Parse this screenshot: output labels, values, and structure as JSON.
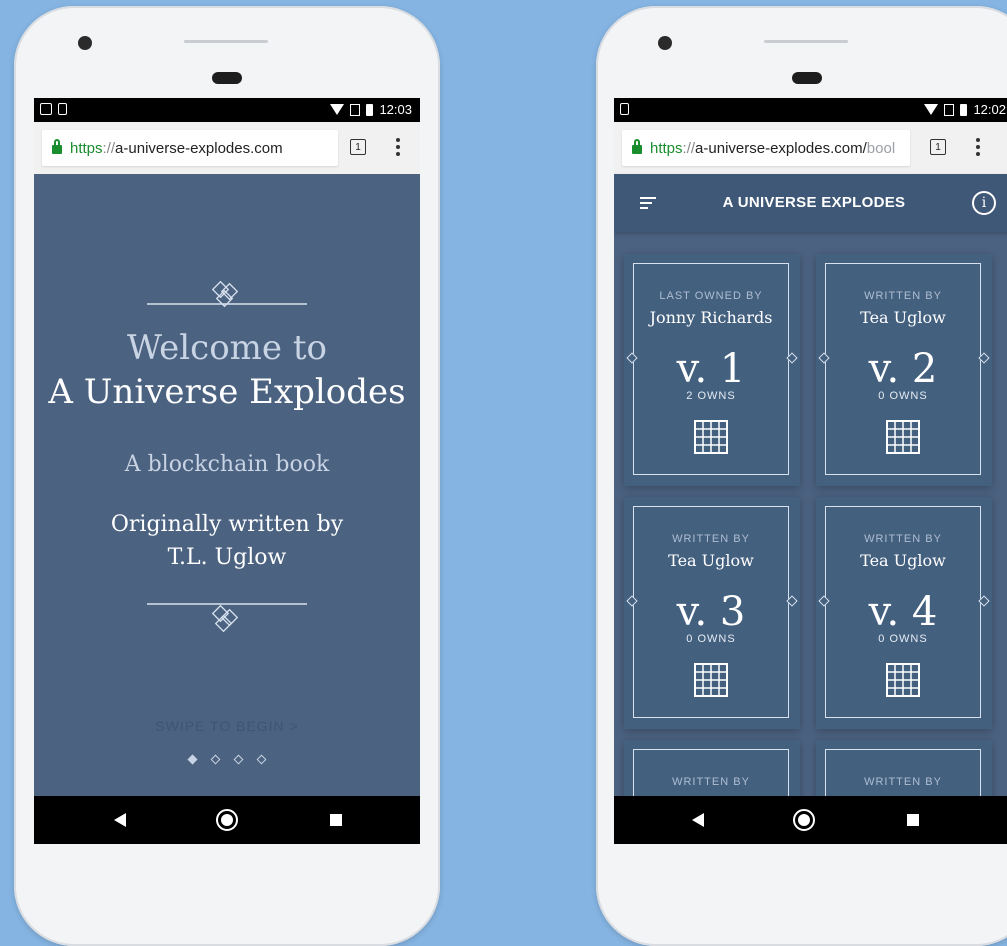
{
  "left_phone": {
    "status": {
      "time": "12:03"
    },
    "browser": {
      "url_scheme": "https",
      "url_sep": "://",
      "url_rest": "a-universe-explodes.com",
      "tab_count": "1"
    },
    "welcome": {
      "line1": "Welcome to",
      "title": "A Universe Explodes",
      "subtitle": "A blockchain book",
      "originally": "Originally written by",
      "author": "T.L. Uglow",
      "swipe": "SWIPE TO BEGIN >",
      "page_index": 1,
      "page_count": 4
    }
  },
  "right_phone": {
    "status": {
      "time": "12:02"
    },
    "browser": {
      "url_scheme": "https",
      "url_sep": "://",
      "url_rest": "a-universe-explodes.com/",
      "url_faded": "bool",
      "tab_count": "1"
    },
    "appbar": {
      "title": "A UNIVERSE EXPLODES",
      "menu_icon": "menu-icon",
      "info_icon": "info-icon",
      "info_glyph": "i"
    },
    "cards": [
      {
        "label": "LAST OWNED BY",
        "name": "Jonny Richards",
        "version": "v. 1",
        "owns": "2 OWNS"
      },
      {
        "label": "WRITTEN BY",
        "name": "Tea Uglow",
        "version": "v. 2",
        "owns": "0 OWNS"
      },
      {
        "label": "WRITTEN BY",
        "name": "Tea Uglow",
        "version": "v. 3",
        "owns": "0 OWNS"
      },
      {
        "label": "WRITTEN BY",
        "name": "Tea Uglow",
        "version": "v. 4",
        "owns": "0 OWNS"
      },
      {
        "label": "WRITTEN BY",
        "name": "",
        "version": "",
        "owns": ""
      },
      {
        "label": "WRITTEN BY",
        "name": "",
        "version": "",
        "owns": ""
      }
    ]
  },
  "colors": {
    "background": "#85b4e2",
    "screen": "#4b6281",
    "card": "#44607f",
    "appbar": "#3f5877",
    "secure_green": "#1a8d2e"
  }
}
